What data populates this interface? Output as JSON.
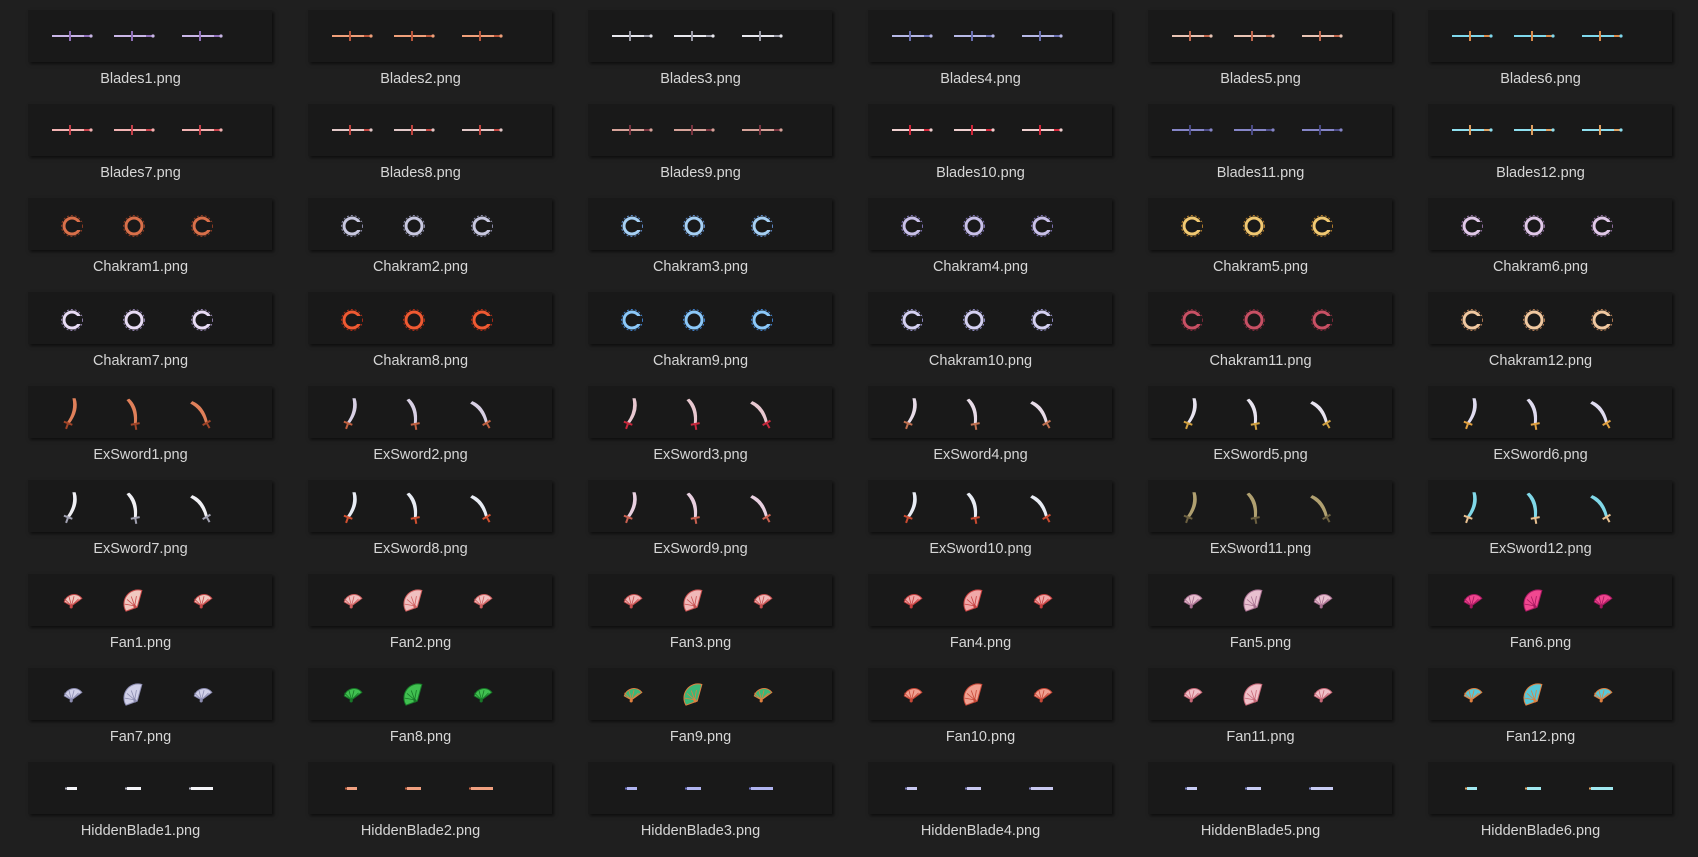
{
  "window": {
    "view": "large-icons"
  },
  "files": [
    {
      "name": "Blades1.png",
      "kind": "blade",
      "colors": [
        "#c9b6e6",
        "#8f6fb8"
      ]
    },
    {
      "name": "Blades2.png",
      "kind": "blade",
      "colors": [
        "#f0a07a",
        "#b8553a"
      ]
    },
    {
      "name": "Blades3.png",
      "kind": "blade",
      "colors": [
        "#e8e8ee",
        "#9a9aa6"
      ]
    },
    {
      "name": "Blades4.png",
      "kind": "blade",
      "colors": [
        "#b7b9e6",
        "#6a6fb0"
      ]
    },
    {
      "name": "Blades5.png",
      "kind": "blade",
      "colors": [
        "#e9c4b4",
        "#c0674d"
      ]
    },
    {
      "name": "Blades6.png",
      "kind": "blade",
      "colors": [
        "#7fd8ec",
        "#d98a4a"
      ]
    },
    {
      "name": "Blades7.png",
      "kind": "blade",
      "colors": [
        "#f3b3b3",
        "#c7404a"
      ]
    },
    {
      "name": "Blades8.png",
      "kind": "blade",
      "colors": [
        "#e2c8c8",
        "#c2443f"
      ]
    },
    {
      "name": "Blades9.png",
      "kind": "blade",
      "colors": [
        "#d7a39a",
        "#7b3440"
      ]
    },
    {
      "name": "Blades10.png",
      "kind": "blade",
      "colors": [
        "#f0d0d0",
        "#d3263a"
      ]
    },
    {
      "name": "Blades11.png",
      "kind": "blade",
      "colors": [
        "#8686c8",
        "#4b4b86"
      ]
    },
    {
      "name": "Blades12.png",
      "kind": "blade",
      "colors": [
        "#8fe0f0",
        "#e0a060"
      ]
    },
    {
      "name": "Chakram1.png",
      "kind": "chakram",
      "colors": [
        "#d9704a",
        "#8a3a22"
      ]
    },
    {
      "name": "Chakram2.png",
      "kind": "chakram",
      "colors": [
        "#c8c8e0",
        "#8a8aa8"
      ]
    },
    {
      "name": "Chakram3.png",
      "kind": "chakram",
      "colors": [
        "#a6d0f4",
        "#5c86c4"
      ]
    },
    {
      "name": "Chakram4.png",
      "kind": "chakram",
      "colors": [
        "#c8c0e8",
        "#7c70b0"
      ]
    },
    {
      "name": "Chakram5.png",
      "kind": "chakram",
      "colors": [
        "#f0c872",
        "#b07a2c"
      ]
    },
    {
      "name": "Chakram6.png",
      "kind": "chakram",
      "colors": [
        "#e0c8e8",
        "#8c6c9c"
      ]
    },
    {
      "name": "Chakram7.png",
      "kind": "chakram",
      "colors": [
        "#e8dcf4",
        "#8c7ca8"
      ]
    },
    {
      "name": "Chakram8.png",
      "kind": "chakram",
      "colors": [
        "#f05a32",
        "#a82a14"
      ]
    },
    {
      "name": "Chakram9.png",
      "kind": "chakram",
      "colors": [
        "#8cc8f8",
        "#3c7cc8"
      ]
    },
    {
      "name": "Chakram10.png",
      "kind": "chakram",
      "colors": [
        "#d4d0f0",
        "#8c88c0"
      ]
    },
    {
      "name": "Chakram11.png",
      "kind": "chakram",
      "colors": [
        "#c85064",
        "#7c2838"
      ]
    },
    {
      "name": "Chakram12.png",
      "kind": "chakram",
      "colors": [
        "#f0c8a0",
        "#b07850"
      ]
    },
    {
      "name": "ExSword1.png",
      "kind": "sword",
      "colors": [
        "#e0805a",
        "#a04428"
      ]
    },
    {
      "name": "ExSword2.png",
      "kind": "sword",
      "colors": [
        "#d8d0e4",
        "#c06040"
      ]
    },
    {
      "name": "ExSword3.png",
      "kind": "sword",
      "colors": [
        "#e8c8d0",
        "#c8283c"
      ]
    },
    {
      "name": "ExSword4.png",
      "kind": "sword",
      "colors": [
        "#e8dce8",
        "#c07050"
      ]
    },
    {
      "name": "ExSword5.png",
      "kind": "sword",
      "colors": [
        "#e8e4f0",
        "#d0a040"
      ]
    },
    {
      "name": "ExSword6.png",
      "kind": "sword",
      "colors": [
        "#e0dcf0",
        "#e0a040"
      ]
    },
    {
      "name": "ExSword7.png",
      "kind": "sword",
      "colors": [
        "#f0f0f4",
        "#a0a0b0"
      ]
    },
    {
      "name": "ExSword8.png",
      "kind": "sword",
      "colors": [
        "#e8ecf4",
        "#d05030"
      ]
    },
    {
      "name": "ExSword9.png",
      "kind": "sword",
      "colors": [
        "#e8d0e0",
        "#c86050"
      ]
    },
    {
      "name": "ExSword10.png",
      "kind": "sword",
      "colors": [
        "#e8ecf4",
        "#c84a30"
      ]
    },
    {
      "name": "ExSword11.png",
      "kind": "sword",
      "colors": [
        "#b0a070",
        "#6c6040"
      ]
    },
    {
      "name": "ExSword12.png",
      "kind": "sword",
      "colors": [
        "#80d8e8",
        "#e8c090"
      ]
    },
    {
      "name": "Fan1.png",
      "kind": "fan",
      "colors": [
        "#f0c8c0",
        "#c84a4a"
      ]
    },
    {
      "name": "Fan2.png",
      "kind": "fan",
      "colors": [
        "#f0c0c0",
        "#d06060"
      ]
    },
    {
      "name": "Fan3.png",
      "kind": "fan",
      "colors": [
        "#f0b8b8",
        "#c85050"
      ]
    },
    {
      "name": "Fan4.png",
      "kind": "fan",
      "colors": [
        "#f0a8a8",
        "#c84040"
      ]
    },
    {
      "name": "Fan5.png",
      "kind": "fan",
      "colors": [
        "#e8c0d0",
        "#a87090"
      ]
    },
    {
      "name": "Fan6.png",
      "kind": "fan",
      "colors": [
        "#f04890",
        "#a81860"
      ]
    },
    {
      "name": "Fan7.png",
      "kind": "fan",
      "colors": [
        "#d0d0e8",
        "#8c8cb0"
      ]
    },
    {
      "name": "Fan8.png",
      "kind": "fan",
      "colors": [
        "#40c050",
        "#187828"
      ]
    },
    {
      "name": "Fan9.png",
      "kind": "fan",
      "colors": [
        "#3cb878",
        "#e08040"
      ]
    },
    {
      "name": "Fan10.png",
      "kind": "fan",
      "colors": [
        "#f0a090",
        "#c84838"
      ]
    },
    {
      "name": "Fan11.png",
      "kind": "fan",
      "colors": [
        "#f0c0c8",
        "#c86878"
      ]
    },
    {
      "name": "Fan12.png",
      "kind": "fan",
      "colors": [
        "#58c8d8",
        "#e08040"
      ]
    },
    {
      "name": "HiddenBlade1.png",
      "kind": "hidden",
      "colors": [
        "#f4f4f8",
        "#b0b0c0"
      ]
    },
    {
      "name": "HiddenBlade2.png",
      "kind": "hidden",
      "colors": [
        "#f0a080",
        "#c06040"
      ]
    },
    {
      "name": "HiddenBlade3.png",
      "kind": "hidden",
      "colors": [
        "#b0b4f0",
        "#6c70c0"
      ]
    },
    {
      "name": "HiddenBlade4.png",
      "kind": "hidden",
      "colors": [
        "#c8c8f0",
        "#7c7cb8"
      ]
    },
    {
      "name": "HiddenBlade5.png",
      "kind": "hidden",
      "colors": [
        "#c8ccf4",
        "#7880c0"
      ]
    },
    {
      "name": "HiddenBlade6.png",
      "kind": "hidden",
      "colors": [
        "#a0e8f0",
        "#e0a060"
      ]
    }
  ]
}
